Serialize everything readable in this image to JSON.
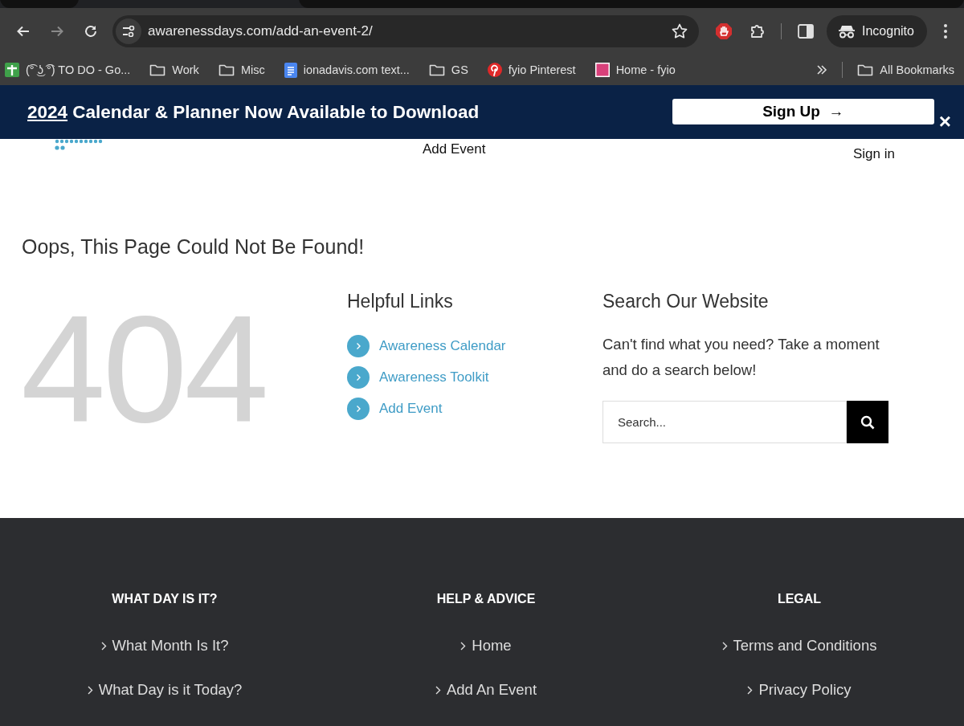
{
  "browser": {
    "nav_buttons": [
      {
        "kind": "back",
        "disabled": false
      },
      {
        "kind": "forward",
        "disabled": true
      },
      {
        "kind": "reload",
        "disabled": false
      }
    ],
    "address": "awarenessdays.com/add-an-event-2/",
    "profile": "Incognito",
    "bookmarks": [
      {
        "kind": "sheet",
        "label": "(͡° ͜ʖ ͡°) TO DO - Go..."
      },
      {
        "kind": "folder",
        "label": "Work"
      },
      {
        "kind": "folder",
        "label": "Misc"
      },
      {
        "kind": "doc",
        "label": "ionadavis.com text..."
      },
      {
        "kind": "folder",
        "label": "GS"
      },
      {
        "kind": "pinterest",
        "label": "fyio Pinterest"
      },
      {
        "kind": "fyio",
        "label": "Home - fyio"
      }
    ],
    "all_bookmarks": "All Bookmarks"
  },
  "banner": {
    "year": "2024",
    "text": "Calendar & Planner Now Available to Download",
    "button": "Sign Up",
    "button_arrow": "→",
    "close": "×"
  },
  "header": {
    "nav": "Add Event",
    "sign_in": "Sign in"
  },
  "page_title": "Oops, This Page Could Not Be Found!",
  "error_code": "404",
  "helpful_links": {
    "heading": "Helpful Links",
    "links": [
      "Awareness Calendar",
      "Awareness Toolkit",
      "Add Event"
    ]
  },
  "search": {
    "heading": "Search Our Website",
    "text": "Can't find what you need? Take a moment and do a search below!",
    "placeholder": "Search..."
  },
  "footer": [
    {
      "heading": "WHAT DAY IS IT?",
      "links": [
        "What Month Is It?",
        "What Day is it Today?"
      ]
    },
    {
      "heading": "HELP & ADVICE",
      "links": [
        "Home",
        "Add An Event"
      ]
    },
    {
      "heading": "LEGAL",
      "links": [
        "Terms and Conditions",
        "Privacy Policy"
      ]
    }
  ]
}
